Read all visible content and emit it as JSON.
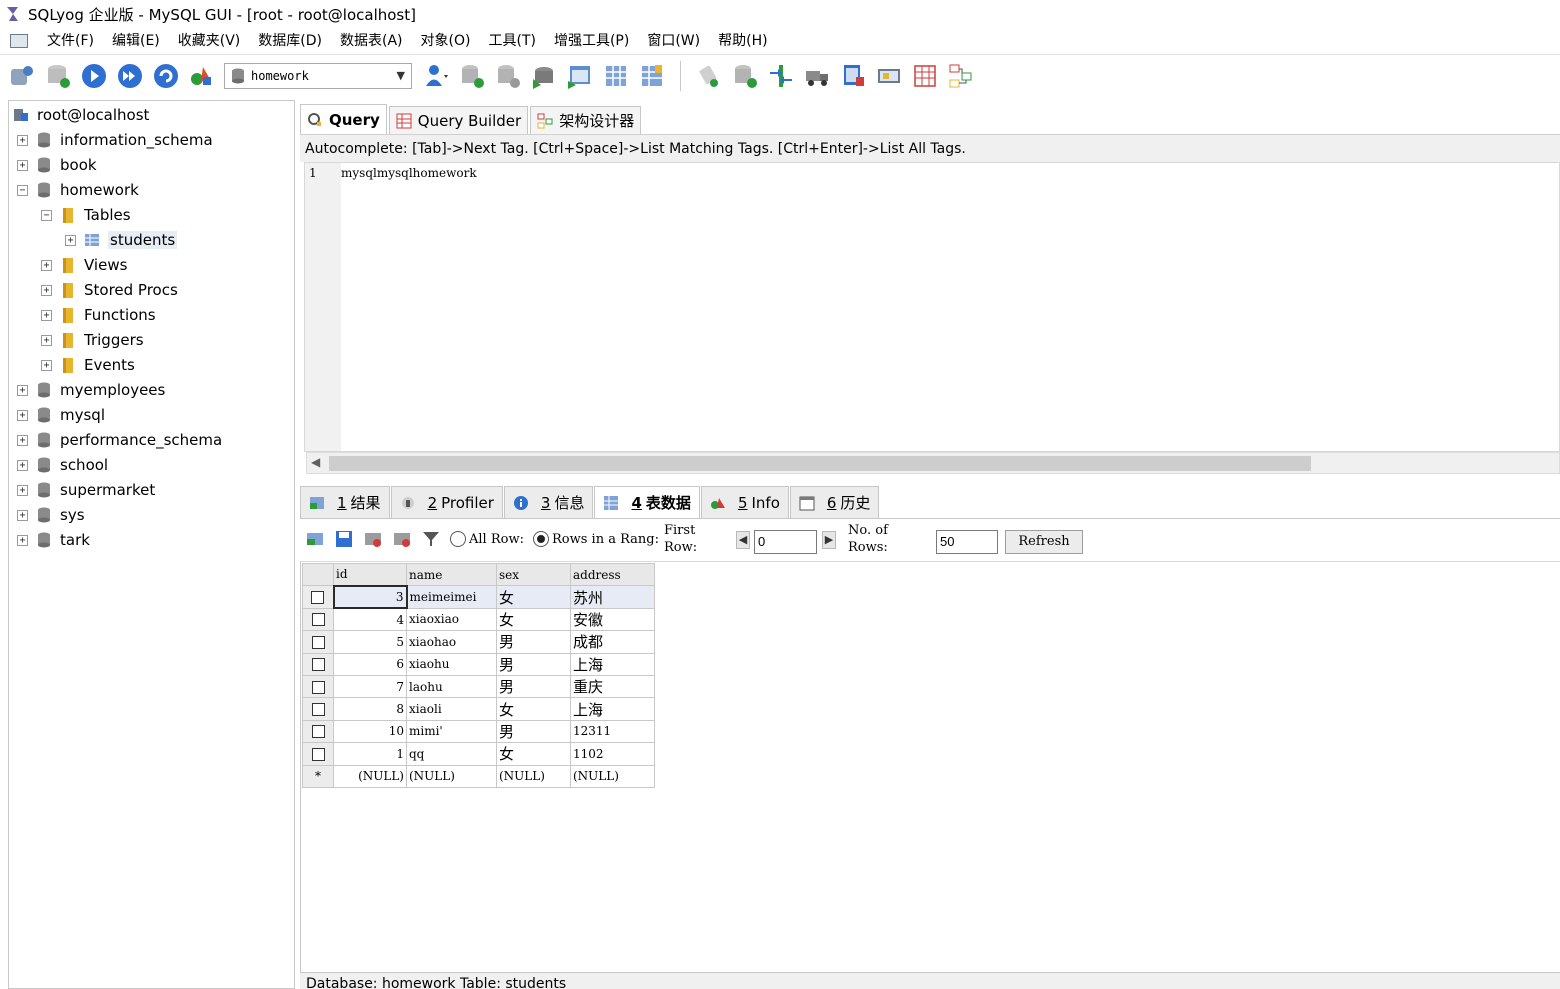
{
  "window": {
    "title": "SQLyog 企业版 - MySQL GUI - [root - root@localhost]"
  },
  "menu": [
    "文件(F)",
    "编辑(E)",
    "收藏夹(V)",
    "数据库(D)",
    "数据表(A)",
    "对象(O)",
    "工具(T)",
    "增强工具(P)",
    "窗口(W)",
    "帮助(H)"
  ],
  "toolbar": {
    "database_value": "homework"
  },
  "tree": {
    "root": "root@localhost",
    "databases": [
      "information_schema",
      "book",
      "homework",
      "myemployees",
      "mysql",
      "performance_schema",
      "school",
      "supermarket",
      "sys",
      "tark"
    ],
    "homework_children": [
      "Tables",
      "Views",
      "Stored Procs",
      "Functions",
      "Triggers",
      "Events"
    ],
    "table_item": "students"
  },
  "query_tabs": [
    "Query",
    "Query Builder",
    "架构设计器"
  ],
  "autocomplete_hint": "Autocomplete: [Tab]->Next Tag. [Ctrl+Space]->List Matching Tags. [Ctrl+Enter]->List All Tags.",
  "editor": {
    "line_number": "1",
    "code": "mysqlmysqlhomework"
  },
  "result_tabs": [
    {
      "num": "1",
      "label": "结果"
    },
    {
      "num": "2",
      "label": "Profiler"
    },
    {
      "num": "3",
      "label": "信息"
    },
    {
      "num": "4",
      "label": "表数据"
    },
    {
      "num": "5",
      "label": "Info"
    },
    {
      "num": "6",
      "label": "历史"
    }
  ],
  "result_toolbar": {
    "all_rows_label": "All Row:",
    "range_label": "Rows in a Rang:",
    "first_row_label_1": "First",
    "first_row_label_2": "Row:",
    "first_row_value": "0",
    "num_rows_label_1": "No. of",
    "num_rows_label_2": "Rows:",
    "num_rows_value": "50",
    "refresh_label": "Refresh"
  },
  "grid": {
    "columns": [
      "id",
      "name",
      "sex",
      "address"
    ],
    "rows": [
      [
        "3",
        "meimeimei",
        "女",
        "苏州"
      ],
      [
        "4",
        "xiaoxiao",
        "女",
        "安徽"
      ],
      [
        "5",
        "xiaohao",
        "男",
        "成都"
      ],
      [
        "6",
        "xiaohu",
        "男",
        "上海"
      ],
      [
        "7",
        "laohu",
        "男",
        "重庆"
      ],
      [
        "8",
        "xiaoli",
        "女",
        "上海"
      ],
      [
        "10",
        "mimi'",
        "男",
        "12311"
      ],
      [
        "1",
        "qq",
        "女",
        "1102"
      ]
    ],
    "new_row_marker": "*",
    "null_text": "(NULL)"
  },
  "status": {
    "text": "Database: homework  Table: students"
  },
  "colors": {
    "folder": "#e8b531",
    "db_icon": "#7d7d7d",
    "accent_blue": "#2e6fd1",
    "accent_green": "#2e9b3b"
  }
}
